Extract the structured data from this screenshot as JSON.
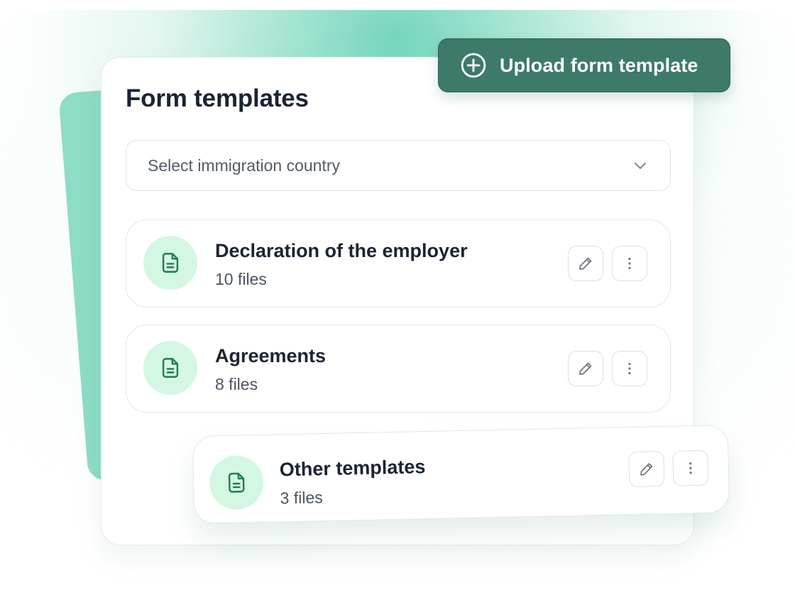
{
  "card": {
    "title": "Form templates"
  },
  "upload_button": {
    "label": "Upload form template",
    "icon": "plus-circle-icon"
  },
  "country_select": {
    "placeholder": "Select immigration country",
    "icon": "chevron-down-icon"
  },
  "templates": [
    {
      "title": "Declaration of the employer",
      "count": "10 files",
      "icon": "document-icon"
    },
    {
      "title": "Agreements",
      "count": "8 files",
      "icon": "document-icon"
    },
    {
      "title": "Other templates",
      "count": "3 files",
      "icon": "document-icon"
    }
  ],
  "row_actions": {
    "edit_icon": "pencil-icon",
    "more_icon": "vertical-dots-icon"
  },
  "colors": {
    "accent": "#3d7a6a",
    "icon_green": "#1e7a5a",
    "icon_bg": "#d3f7e3",
    "backdrop": "#8ddcc6"
  }
}
